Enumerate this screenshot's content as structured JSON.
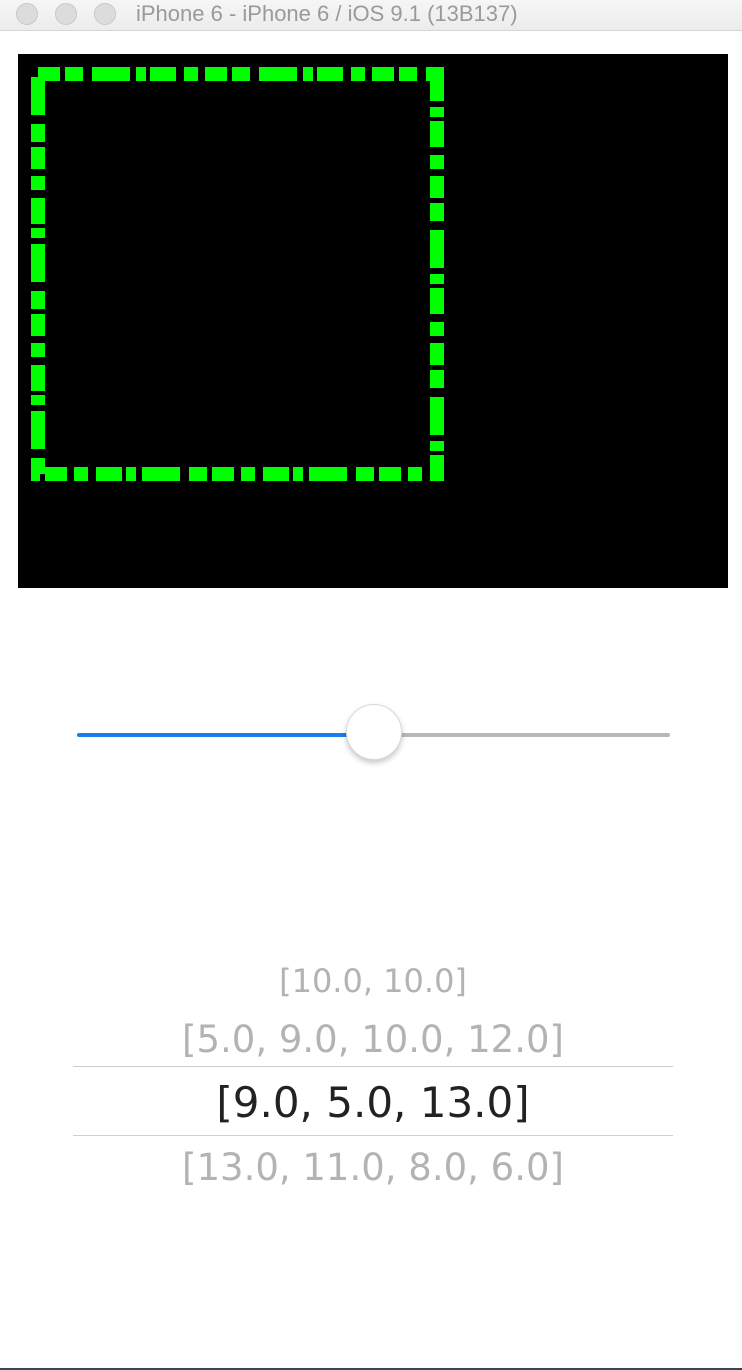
{
  "window": {
    "title": "iPhone 6 - iPhone 6 / iOS 9.1 (13B137)",
    "traffic_lights": [
      "close",
      "minimize",
      "zoom"
    ]
  },
  "canvas": {
    "background": "#000000",
    "stroke_color": "#00ff00",
    "shape": "dashed-rectangle"
  },
  "slider": {
    "value": 0.5,
    "min_track_color": "#1b7ee6",
    "max_track_color": "#b8b8b8"
  },
  "picker": {
    "rows": [
      "[10.0, 10.0]",
      "[5.0, 9.0, 10.0, 12.0]",
      "[9.0, 5.0, 13.0]",
      "[13.0, 11.0, 8.0, 6.0]"
    ],
    "selected_index": 2
  }
}
